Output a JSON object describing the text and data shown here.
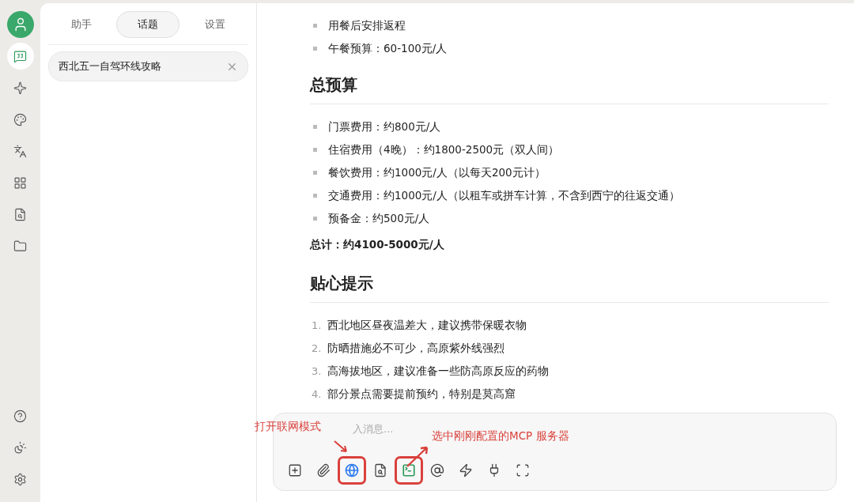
{
  "rail": {
    "top": [
      {
        "kind": "chat",
        "selected": true
      },
      {
        "kind": "sparkle",
        "selected": false
      },
      {
        "kind": "palette",
        "selected": false
      },
      {
        "kind": "translate",
        "selected": false
      },
      {
        "kind": "apps",
        "selected": false
      },
      {
        "kind": "file-search",
        "selected": false
      },
      {
        "kind": "folder",
        "selected": false
      }
    ],
    "bottom": [
      {
        "kind": "help",
        "selected": false
      },
      {
        "kind": "theme",
        "selected": false
      },
      {
        "kind": "settings",
        "selected": false
      }
    ]
  },
  "sidebar": {
    "tabs": [
      {
        "label": "助手",
        "selected": false
      },
      {
        "label": "话题",
        "selected": true
      },
      {
        "label": "设置",
        "selected": false
      }
    ],
    "topics": [
      {
        "title": "西北五一自驾环线攻略",
        "selected": true
      }
    ]
  },
  "content": [
    {
      "kind": "bullets",
      "items": [
        "用餐后安排返程",
        "午餐预算：60-100元/人"
      ]
    },
    {
      "kind": "heading",
      "text": "总预算"
    },
    {
      "kind": "bullets",
      "items": [
        "门票费用：约800元/人",
        "住宿费用（4晚）：约1800-2500元（双人间）",
        "餐饮费用：约1000元/人（以每天200元计）",
        "交通费用：约1000元/人（以租车或拼车计算，不含到西宁的往返交通）",
        "预备金：约500元/人"
      ]
    },
    {
      "kind": "strong",
      "text": "总计：约4100-5000元/人"
    },
    {
      "kind": "heading",
      "text": "贴心提示"
    },
    {
      "kind": "numbered",
      "items": [
        {
          "number": "1.",
          "text": "西北地区昼夜温差大，建议携带保暖衣物"
        },
        {
          "number": "2.",
          "text": "防晒措施必不可少，高原紫外线强烈"
        },
        {
          "number": "3.",
          "text": "高海拔地区，建议准备一些防高原反应的药物"
        },
        {
          "number": "4.",
          "text": "部分景点需要提前预约，特别是莫高窟"
        }
      ]
    }
  ],
  "composer": {
    "placeholder": "入消息...",
    "tools": [
      {
        "kind": "new-topic",
        "highlighted": false
      },
      {
        "kind": "attach",
        "highlighted": false
      },
      {
        "kind": "web-search",
        "highlighted": true,
        "color": "#2f7bf0"
      },
      {
        "kind": "file-search",
        "highlighted": false
      },
      {
        "kind": "mcp",
        "highlighted": true,
        "color": "#2e9a5a"
      },
      {
        "kind": "mention",
        "highlighted": false
      },
      {
        "kind": "quick",
        "highlighted": false
      },
      {
        "kind": "plugin",
        "highlighted": false
      },
      {
        "kind": "fullscreen",
        "highlighted": false
      }
    ]
  },
  "annotations": [
    {
      "kind": "web",
      "text": "打开联网模式"
    },
    {
      "kind": "mcp",
      "text": "选中刚刚配置的MCP 服务器"
    }
  ]
}
